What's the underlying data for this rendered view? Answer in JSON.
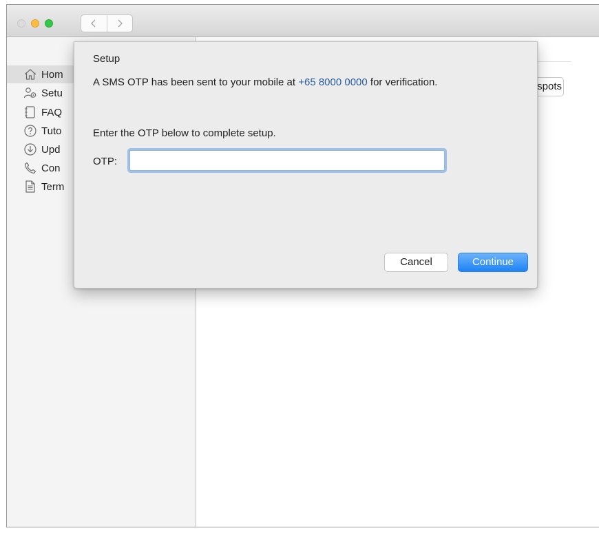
{
  "sidebar": {
    "items": [
      {
        "label": "Hom",
        "icon": "home-icon",
        "active": true
      },
      {
        "label": "Setu",
        "icon": "setup-users-icon",
        "active": false
      },
      {
        "label": "FAQ",
        "icon": "faq-book-icon",
        "active": false
      },
      {
        "label": "Tuto",
        "icon": "help-circle-icon",
        "active": false
      },
      {
        "label": "Upd",
        "icon": "download-circle-icon",
        "active": false
      },
      {
        "label": "Con",
        "icon": "phone-icon",
        "active": false
      },
      {
        "label": "Term",
        "icon": "document-icon",
        "active": false
      }
    ]
  },
  "content": {
    "hotspots_button": "tspots"
  },
  "dialog": {
    "title": "Setup",
    "message_prefix": "A SMS OTP has been sent to your mobile at ",
    "phone": "+65 8000 0000",
    "message_suffix": " for verification.",
    "instruction": "Enter the OTP below to complete setup.",
    "otp_label": "OTP:",
    "otp_value": "",
    "cancel_label": "Cancel",
    "continue_label": "Continue"
  },
  "colors": {
    "accent": "#1d83f6",
    "link": "#2a5f9e"
  }
}
